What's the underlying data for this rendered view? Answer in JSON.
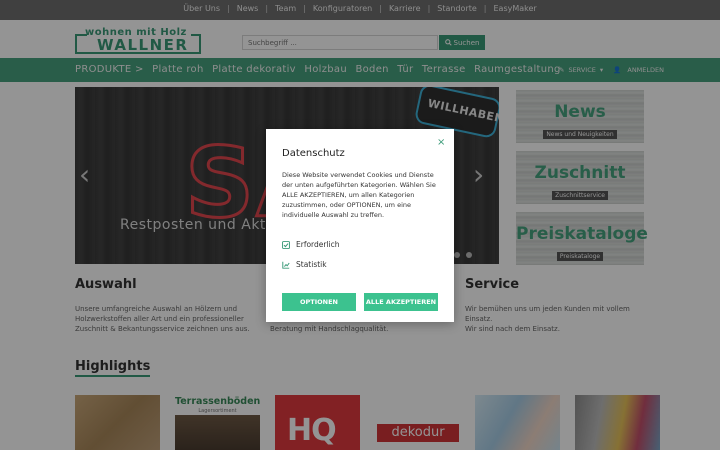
{
  "topbar": {
    "links": [
      "Über Uns",
      "News",
      "Team",
      "Konfiguratoren",
      "Karriere",
      "Standorte",
      "EasyMaker"
    ]
  },
  "header": {
    "logo_line1": "wohnen mit Holz",
    "logo_line2": "WALLNER",
    "search_placeholder": "Suchbegriff ...",
    "search_button": "Suchen"
  },
  "nav": {
    "items": [
      "PRODUKTE >",
      "Platte roh",
      "Platte dekorativ",
      "Holzbau",
      "Boden",
      "Tür",
      "Terrasse",
      "Raumgestaltung"
    ],
    "service": "SERVICE",
    "login": "ANMELDEN"
  },
  "slider": {
    "sign_text": "WILLHABEN",
    "big_text": "SA",
    "caption": "Restposten und Aktionen"
  },
  "tiles": [
    {
      "title": "News",
      "subtitle": "News und Neuigkeiten"
    },
    {
      "title": "Zuschnitt",
      "subtitle": "Zuschnittservice"
    },
    {
      "title": "Preiskataloge",
      "subtitle": "Preiskataloge"
    }
  ],
  "sections": {
    "auswahl_title": "Auswahl",
    "auswahl_text": [
      "Unsere umfangreiche Auswahl an Hölzern und",
      "Holzwerkstoffen aller Art und ein professioneller",
      "Zuschnitt & Bekantungsservice zeichnen uns aus."
    ],
    "beratung_text": "Beratung mit Handschlagqualität.",
    "service_title": "Service",
    "service_text": [
      "Wir bemühen uns um jeden Kunden mit vollem",
      "Einsatz.",
      "Wir sind nach dem Einsatz."
    ]
  },
  "highlights": {
    "title": "Highlights",
    "terrassen_title": "Terrassenböden",
    "terrassen_sub": "Lagersortiment",
    "hq": "HQ",
    "dekodur": "dekodur"
  },
  "modal": {
    "title": "Datenschutz",
    "close": "×",
    "text": "Diese Website verwendet Cookies und Dienste der unten aufgeführten Kategorien. Wählen Sie ALLE AKZEPTIEREN, um allen Kategorien zuzustimmen, oder OPTIONEN, um eine individuelle Auswahl zu treffen.",
    "options": [
      "Erforderlich",
      "Statistik"
    ],
    "btn_options": "OPTIONEN",
    "btn_accept": "ALLE AKZEPTIEREN"
  },
  "colors": {
    "brand_green": "#3a9a78",
    "nav_green": "#47a07f",
    "button_green": "#3cc28f"
  }
}
